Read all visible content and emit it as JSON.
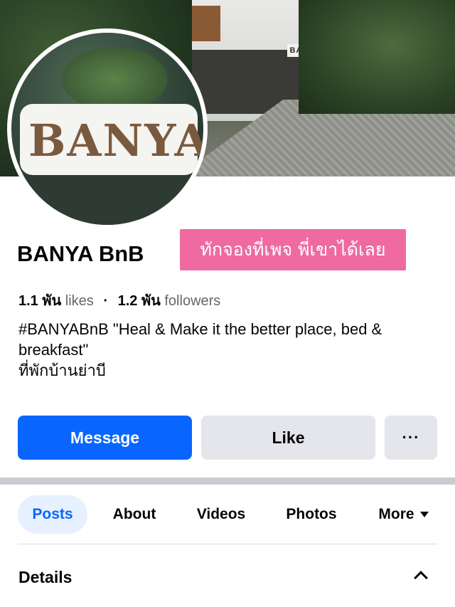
{
  "cover": {
    "sign_text": "BANYA"
  },
  "avatar": {
    "logo_text": "BANYA"
  },
  "page": {
    "name": "BANYA BnB",
    "promo_tag": "ทักจองที่เพจ พี่เขาได้เลย"
  },
  "stats": {
    "likes_count": "1.1 พัน",
    "likes_label": "likes",
    "separator": "·",
    "followers_count": "1.2 พัน",
    "followers_label": "followers"
  },
  "bio": {
    "line1": "#BANYABnB \"Heal & Make it the better place, bed & breakfast\"",
    "line2": "ที่พักบ้านย่าบี"
  },
  "actions": {
    "message_label": "Message",
    "like_label": "Like",
    "more_label": "···"
  },
  "tabs": [
    {
      "label": "Posts",
      "active": true
    },
    {
      "label": "About"
    },
    {
      "label": "Videos"
    },
    {
      "label": "Photos"
    },
    {
      "label": "More"
    }
  ],
  "details": {
    "title": "Details"
  },
  "colors": {
    "accent": "#0866ff",
    "promo": "#ef6aa1",
    "button_gray": "#e4e6eb",
    "active_tab_bg": "#e7f0fe"
  }
}
